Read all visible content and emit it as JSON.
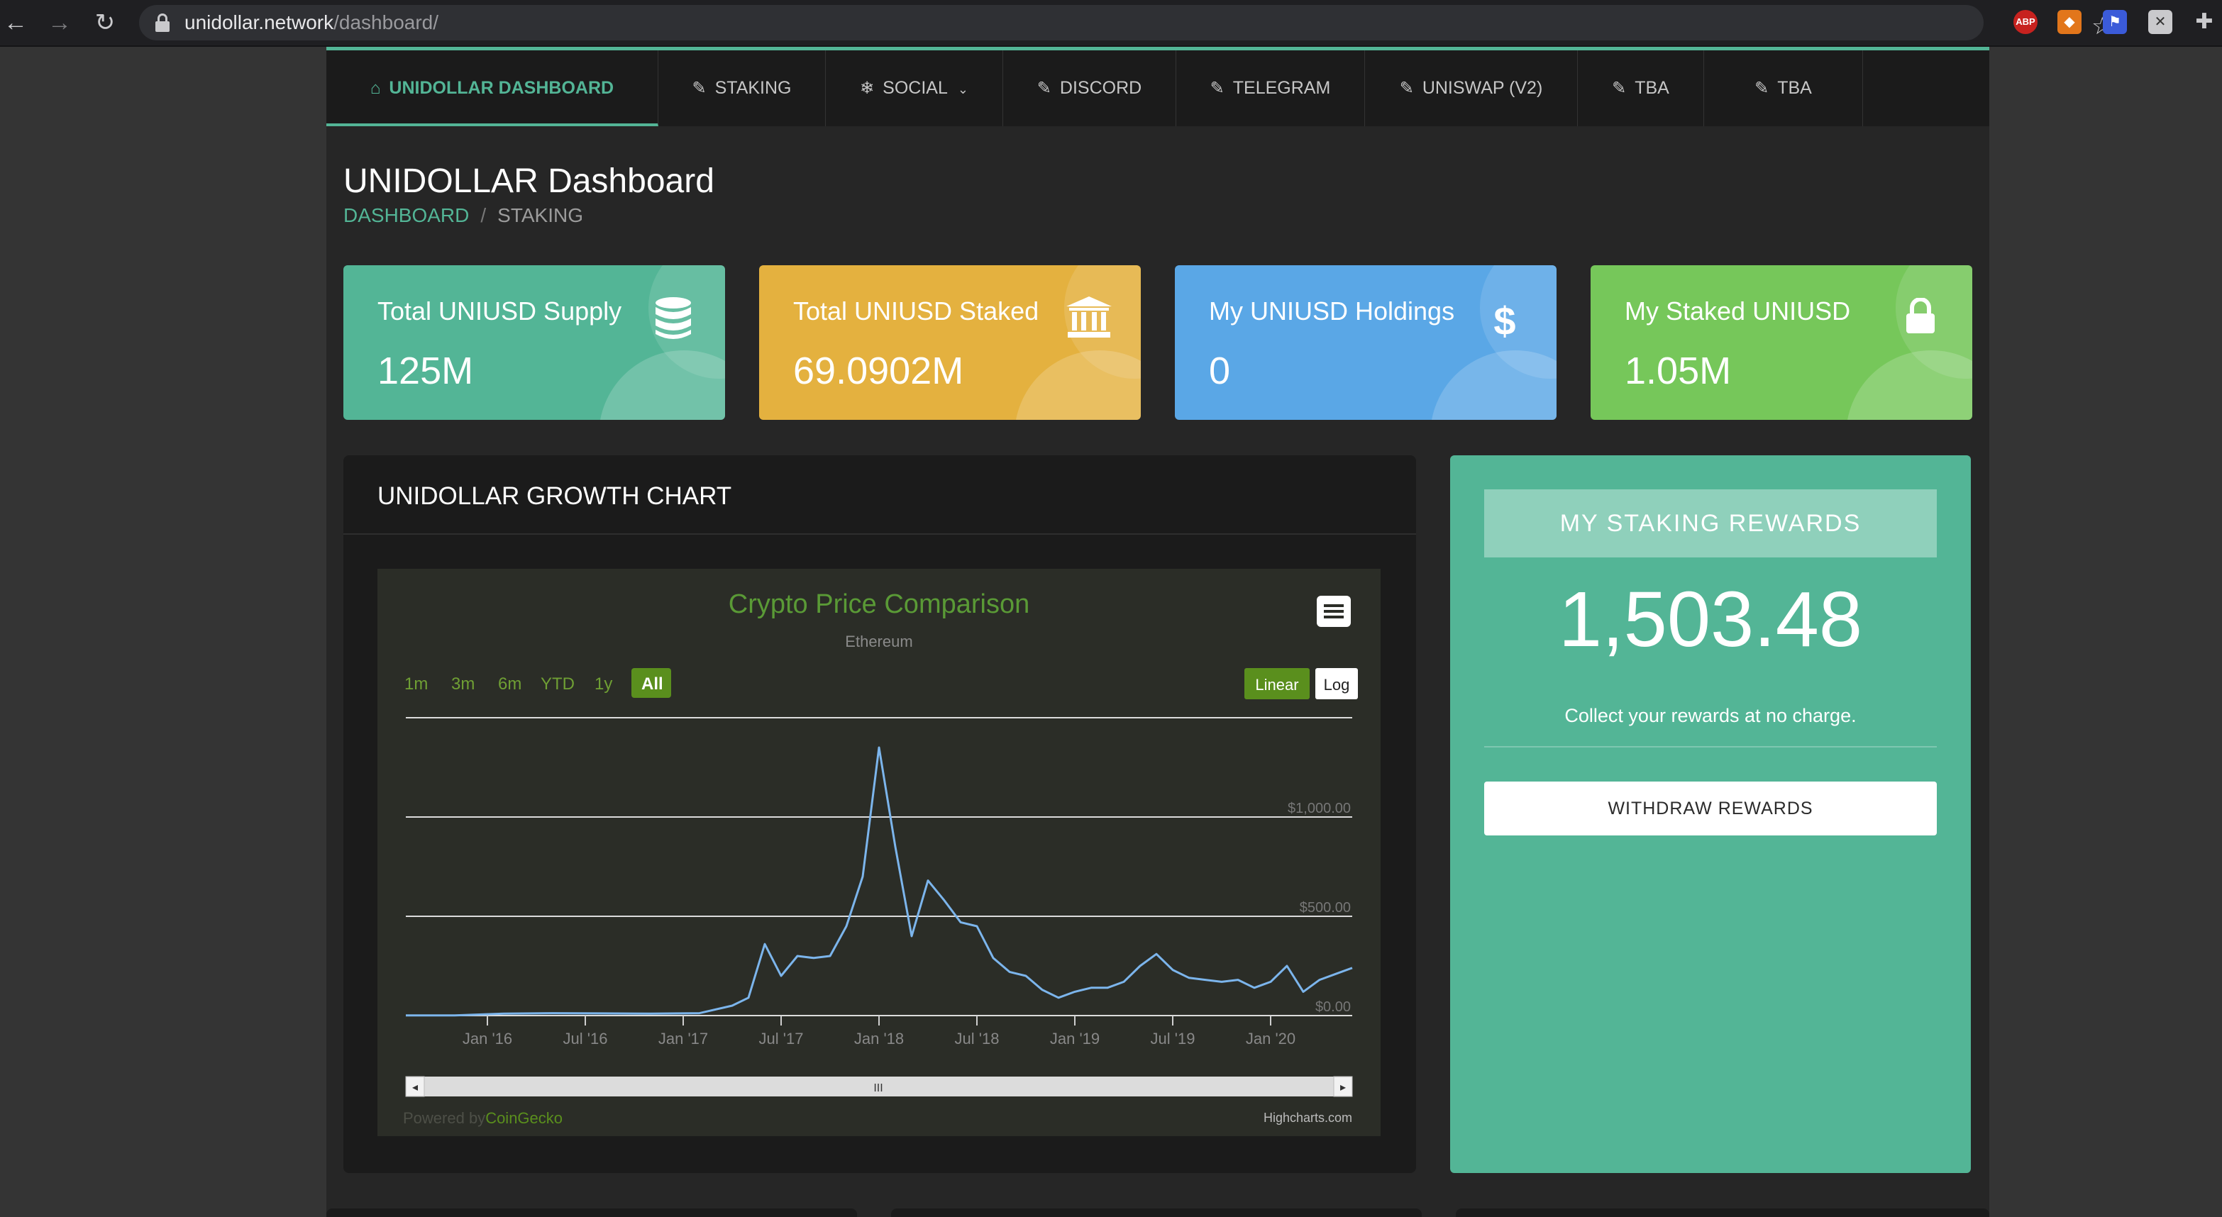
{
  "browser": {
    "url_host": "unidollar.network",
    "url_path": "/dashboard/",
    "extensions": [
      "abp-icon",
      "metamask-icon",
      "flag-icon",
      "tool-icon",
      "puzzle-icon"
    ],
    "abp_label": "ABP"
  },
  "nav": {
    "items": [
      {
        "label": "UNIDOLLAR DASHBOARD",
        "icon": "home-icon",
        "glyph": "⌂",
        "active": true
      },
      {
        "label": "STAKING",
        "icon": "edit-icon",
        "glyph": "✎"
      },
      {
        "label": "SOCIAL",
        "icon": "snowflake-icon",
        "glyph": "❄",
        "dropdown": true
      },
      {
        "label": "DISCORD",
        "icon": "edit-icon",
        "glyph": "✎"
      },
      {
        "label": "TELEGRAM",
        "icon": "edit-icon",
        "glyph": "✎"
      },
      {
        "label": "UNISWAP (V2)",
        "icon": "edit-icon",
        "glyph": "✎"
      },
      {
        "label": "TBA",
        "icon": "edit-icon",
        "glyph": "✎"
      },
      {
        "label": "TBA",
        "icon": "edit-icon",
        "glyph": "✎"
      }
    ]
  },
  "page": {
    "title": "UNIDOLLAR Dashboard",
    "breadcrumb": [
      "DASHBOARD",
      "STAKING"
    ]
  },
  "cards": [
    {
      "label": "Total UNIUSD Supply",
      "value": "125M",
      "color": "#53b596",
      "icon": "database-icon"
    },
    {
      "label": "Total UNIUSD Staked",
      "value": "69.0902M",
      "color": "#e4b13f",
      "icon": "bank-icon"
    },
    {
      "label": "My UNIUSD Holdings",
      "value": "0",
      "color": "#5aa7e6",
      "icon": "dollar-icon"
    },
    {
      "label": "My Staked UNIUSD",
      "value": "1.05M",
      "color": "#76c75a",
      "icon": "lock-icon"
    }
  ],
  "growth_chart": {
    "panel_title": "UNIDOLLAR GROWTH CHART",
    "menu_icon": "hamburger-menu-icon",
    "range_buttons": [
      "1m",
      "3m",
      "6m",
      "YTD",
      "1y",
      "All"
    ],
    "range_selected": "All",
    "scale_buttons": [
      "Linear",
      "Log"
    ],
    "scale_selected": "Linear",
    "credit_prefix": "Powered by",
    "credit_brand": "CoinGecko",
    "credit_highcharts": "Highcharts.com",
    "navigator_handle": "III"
  },
  "chart_data": {
    "type": "line",
    "title": "Crypto Price Comparison",
    "subtitle": "Ethereum",
    "x_start": "2015-08",
    "x_end": "2020-06",
    "x_ticks": [
      "Jan '16",
      "Jul '16",
      "Jan '17",
      "Jul '17",
      "Jan '18",
      "Jul '18",
      "Jan '19",
      "Jul '19",
      "Jan '20"
    ],
    "y_ticks": [
      "$0.00",
      "$500.00",
      "$1,000.00"
    ],
    "ylim": [
      0,
      1500
    ],
    "grid": true,
    "line_color": "#7cb5ec",
    "series": [
      {
        "x": [
          "2015-08",
          "2015-11",
          "2016-02",
          "2016-05",
          "2016-08",
          "2016-11",
          "2017-02",
          "2017-04",
          "2017-05",
          "2017-06",
          "2017-07",
          "2017-08",
          "2017-09",
          "2017-10",
          "2017-11",
          "2017-12",
          "2018-01",
          "2018-02",
          "2018-03",
          "2018-04",
          "2018-05",
          "2018-06",
          "2018-07",
          "2018-08",
          "2018-09",
          "2018-10",
          "2018-11",
          "2018-12",
          "2019-01",
          "2019-02",
          "2019-03",
          "2019-04",
          "2019-05",
          "2019-06",
          "2019-07",
          "2019-08",
          "2019-09",
          "2019-10",
          "2019-11",
          "2019-12",
          "2020-01",
          "2020-02",
          "2020-03",
          "2020-04",
          "2020-05",
          "2020-06"
        ],
        "values": [
          1,
          1,
          10,
          12,
          11,
          10,
          12,
          50,
          90,
          360,
          200,
          300,
          290,
          300,
          450,
          700,
          1350,
          850,
          400,
          680,
          580,
          470,
          450,
          290,
          220,
          200,
          130,
          90,
          120,
          140,
          140,
          170,
          250,
          310,
          230,
          190,
          180,
          170,
          180,
          140,
          170,
          250,
          120,
          180,
          210,
          240
        ]
      }
    ]
  },
  "rewards": {
    "title": "MY STAKING REWARDS",
    "amount": "1,503.48",
    "note": "Collect your rewards at no charge.",
    "button": "WITHDRAW REWARDS"
  }
}
